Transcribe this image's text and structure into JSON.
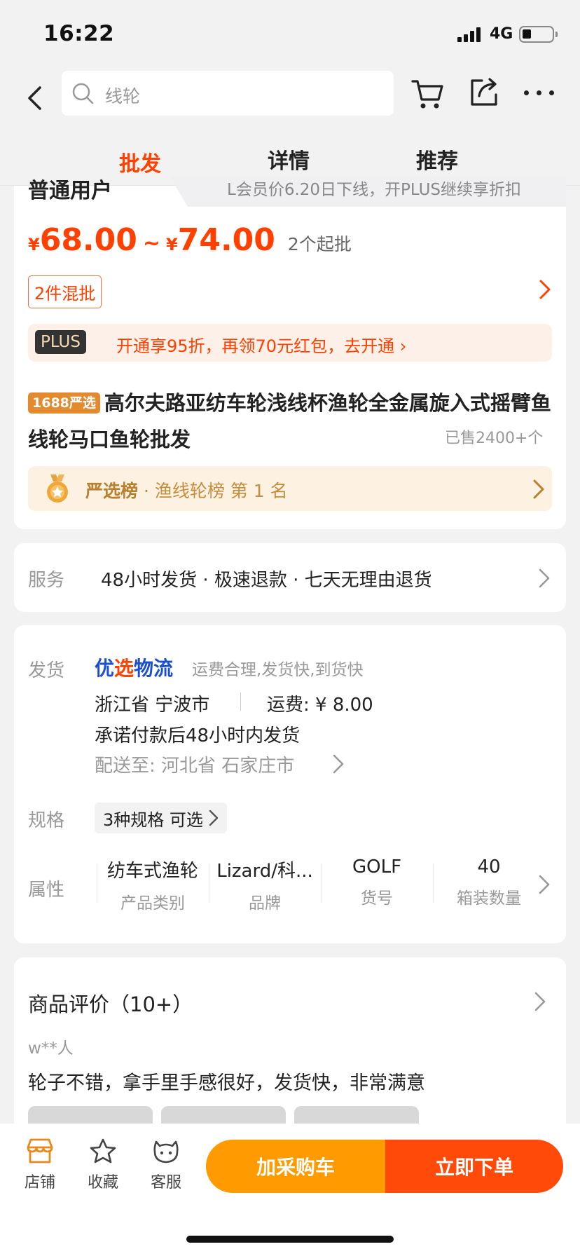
{
  "status": {
    "time": "16:22",
    "network": "4G",
    "battery_level": 0.25
  },
  "nav": {
    "search_placeholder": "线轮"
  },
  "tabs": [
    {
      "label": "批发",
      "active": true
    },
    {
      "label": "详情",
      "active": false
    },
    {
      "label": "推荐",
      "active": false
    }
  ],
  "price_card": {
    "member_left": "普通用户",
    "member_right": "L会员价6.20日下线，开PLUS继续享折扣",
    "currency": "¥",
    "price_low": "68.00",
    "tilde": "~",
    "price_high": "74.00",
    "min_qty": "2个起批",
    "mix_badge": "2件混批",
    "plus_badge": "PLUS",
    "plus_text": "开通享95折，再领70元红包，去开通 ›",
    "title_tag": "1688严选",
    "title": "高尔夫路亚纺车轮浅线杯渔轮全金属旋入式摇臂鱼线轮马口鱼轮批发",
    "sold": "已售2400+个",
    "rank_label": "严选榜",
    "rank_text": " · 渔线轮榜  第 1 名"
  },
  "service": {
    "label": "服务",
    "text": "48小时发货 · 极速退款 · 七天无理由退货"
  },
  "shipping": {
    "label": "发货",
    "logistics_a": "优",
    "logistics_b": "选",
    "logistics_c": "物流",
    "logistics_desc": "运费合理,发货快,到货快",
    "origin": "浙江省 宁波市",
    "fee": "运费: ¥ 8.00",
    "promise": "承诺付款后48小时内发货",
    "deliver_to": "配送至:  河北省 石家庄市"
  },
  "spec": {
    "label": "规格",
    "value": "3种规格 可选"
  },
  "attributes": {
    "label": "属性",
    "items": [
      {
        "value": "纺车式渔轮",
        "key": "产品类别"
      },
      {
        "value": "Lizard/科...",
        "key": "品牌"
      },
      {
        "value": "GOLF",
        "key": "货号"
      },
      {
        "value": "40",
        "key": "箱装数量"
      }
    ]
  },
  "reviews": {
    "title": "商品评价（10+）",
    "user": "w**人",
    "text": "轮子不错，拿手里手感很好，发货快，非常满意"
  },
  "bottom_bar": {
    "store": "店铺",
    "favorite": "收藏",
    "service": "客服",
    "add_cart": "加采购车",
    "buy_now": "立即下单"
  },
  "colors": {
    "accent": "#ff4000",
    "orange_button": "#ff9a00",
    "buy_button": "#ff4a0a",
    "logistics_blue": "#1a4fd0"
  }
}
